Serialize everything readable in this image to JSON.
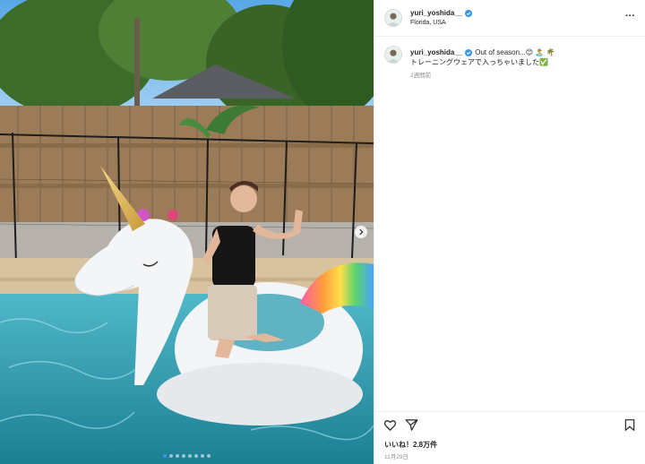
{
  "post": {
    "username": "yuri_yoshida__",
    "location": "Florida, USA",
    "caption_line1": "Out of season...😊 🏝️ 🌴",
    "caption_line2": "トレーニングウェアで入っちゃいました✅",
    "caption_time": "2週間前",
    "likes": "いいね！2.8万件",
    "date": "11月29日",
    "more_label": "···"
  },
  "carousel": {
    "total": 8,
    "active_index": 0
  },
  "colors": {
    "verified": "#3897f0",
    "text": "#262626",
    "muted": "#8e8e8e",
    "border": "#efefef"
  },
  "icons": [
    "more-icon",
    "verified-icon",
    "heart-icon",
    "share-icon",
    "bookmark-icon",
    "next-arrow-icon"
  ]
}
